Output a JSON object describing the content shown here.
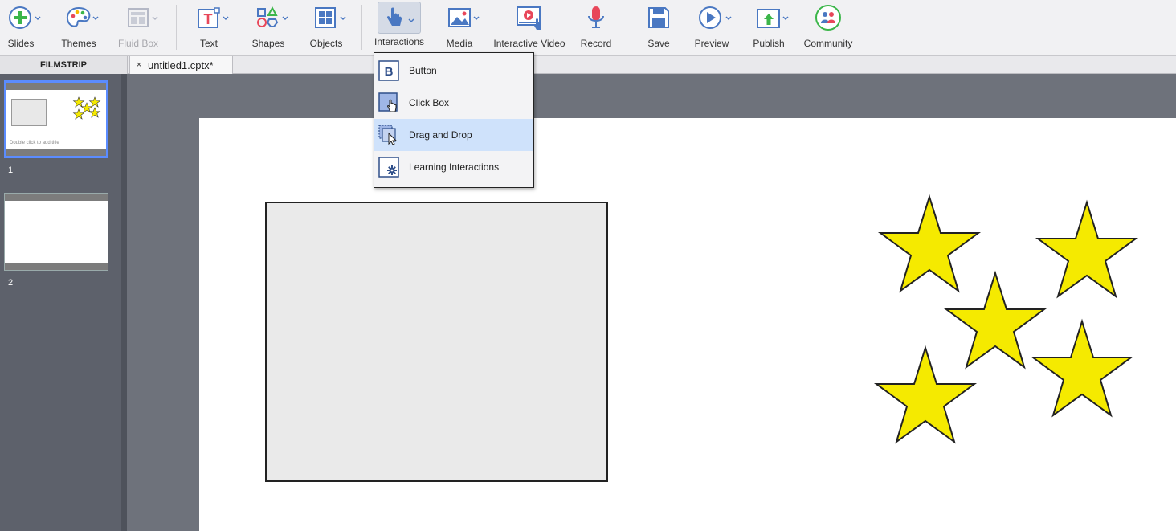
{
  "toolbar": {
    "slides": "Slides",
    "themes": "Themes",
    "fluid_box": "Fluid Box",
    "text": "Text",
    "shapes": "Shapes",
    "objects": "Objects",
    "interactions": "Interactions",
    "media": "Media",
    "interactive_video": "Interactive Video",
    "record": "Record",
    "save": "Save",
    "preview": "Preview",
    "publish": "Publish",
    "community": "Community"
  },
  "filmstrip": {
    "label": "FILMSTRIP",
    "slides": [
      {
        "number": "1",
        "title_placeholder": "Double click to add title"
      },
      {
        "number": "2"
      }
    ]
  },
  "document_tab": {
    "close": "×",
    "filename": "untitled1.cptx*"
  },
  "interactions_menu": {
    "items": [
      {
        "label": "Button",
        "icon": "button-icon"
      },
      {
        "label": "Click Box",
        "icon": "click-box-icon"
      },
      {
        "label": "Drag and Drop",
        "icon": "drag-and-drop-icon",
        "highlighted": true
      },
      {
        "label": "Learning Interactions",
        "icon": "learning-interactions-icon"
      }
    ],
    "button_glyph": "B"
  },
  "colors": {
    "accent_blue": "#4a78c2",
    "selection_blue": "#5b8cff",
    "star_fill": "#f5ea00",
    "record_red": "#e8475a",
    "menu_highlight": "#cfe2fb"
  }
}
